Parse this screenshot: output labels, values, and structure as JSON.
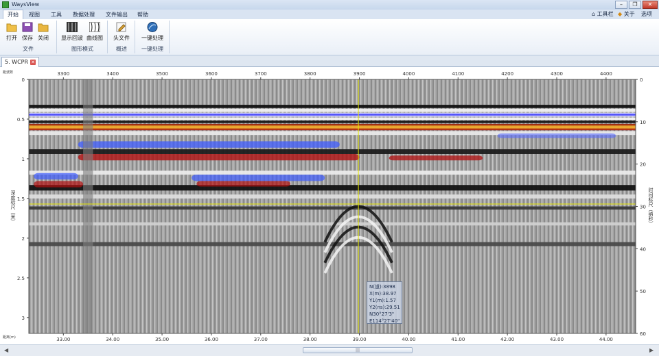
{
  "app": {
    "title": "WaysView"
  },
  "menu": {
    "items": [
      "开始",
      "视图",
      "工具",
      "数据处理",
      "文件输出",
      "帮助"
    ],
    "active_index": 0
  },
  "menu_right": {
    "toolbar": "工具栏",
    "about": "关于",
    "options": "选项"
  },
  "ribbon": {
    "groups": [
      {
        "label": "文件",
        "buttons": [
          "打开",
          "保存",
          "关闭"
        ]
      },
      {
        "label": "图形模式",
        "buttons": [
          "显示回波",
          "曲线图"
        ]
      },
      {
        "label": "概述",
        "buttons": [
          "头文件"
        ]
      },
      {
        "label": "一键处理",
        "buttons": [
          "一键处理"
        ]
      }
    ]
  },
  "document": {
    "tab_label": "5. WCPR"
  },
  "plot": {
    "corner_top_left": "距波数",
    "corner_bottom_left": "距离(m)",
    "y_left_title": "深度标尺（米）",
    "y_right_title": "时间标尺（纳秒）",
    "trace_range": [
      3230,
      4460
    ],
    "distance_range": [
      32.3,
      44.6
    ],
    "depth_range": [
      0,
      3.2
    ],
    "time_range": [
      0,
      60
    ],
    "top_ticks": [
      "3300",
      "3400",
      "3500",
      "3600",
      "3700",
      "3800",
      "3900",
      "4000",
      "4100",
      "4200",
      "4300",
      "4400"
    ],
    "bottom_ticks": [
      "33.00",
      "34.00",
      "35.00",
      "36.00",
      "37.00",
      "38.00",
      "39.00",
      "40.00",
      "41.00",
      "42.00",
      "43.00",
      "44.00"
    ],
    "left_ticks": [
      "0",
      "0.5",
      "1",
      "1.5",
      "2",
      "2.5",
      "3"
    ],
    "right_ticks": [
      "0",
      "10",
      "20",
      "30",
      "40",
      "50",
      "60"
    ],
    "cursor": {
      "trace": 3898,
      "depth_m": 1.57
    },
    "accent_color": "#e6e600"
  },
  "tooltip": {
    "lines": [
      "N(道):3898",
      "X(m):38.97",
      "Y1(m):1.57",
      "Y2(ns):29.51",
      "N30°27'3\"",
      "E114°27'40\""
    ]
  }
}
